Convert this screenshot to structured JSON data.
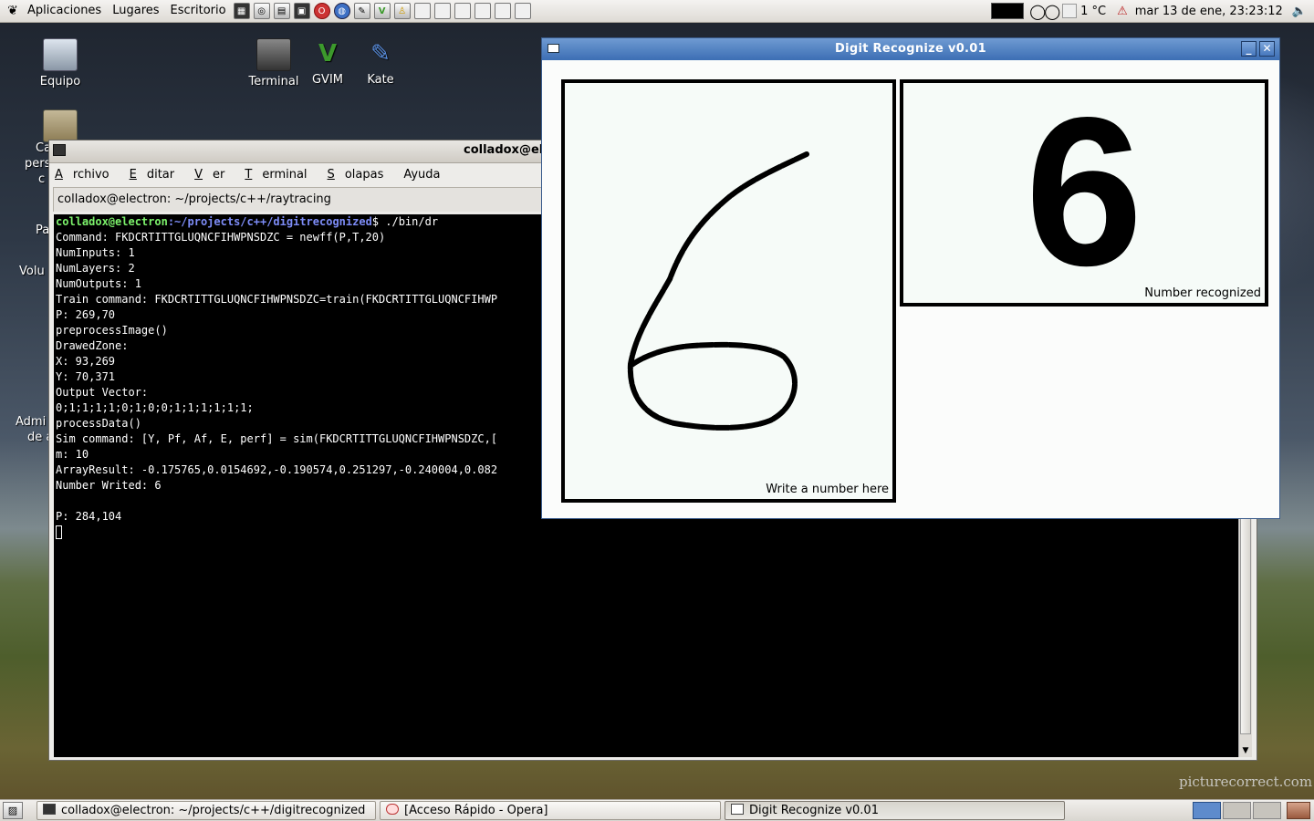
{
  "top_panel": {
    "menus": [
      "Aplicaciones",
      "Lugares",
      "Escritorio"
    ],
    "launchers": [
      "calculator-icon",
      "network-icon",
      "archive-icon",
      "terminal-icon",
      "opera-icon",
      "browser-icon",
      "tools-icon",
      "gvim-icon",
      "user-icon",
      "window-icon-1",
      "window-icon-2",
      "window-icon-3",
      "window-icon-4",
      "window-icon-5",
      "window-icon-6"
    ],
    "temperature": "1 °C",
    "clock": "mar 13 de ene, 23:23:12"
  },
  "desktop": {
    "icons": [
      {
        "label": "Equipo",
        "icon": "computer-icon"
      },
      {
        "label": "Terminal",
        "icon": "terminal-icon"
      },
      {
        "label": "GVIM",
        "icon": "gvim-icon"
      },
      {
        "label": "Kate",
        "icon": "kate-icon"
      }
    ],
    "fragments": [
      "Ca",
      "pers",
      "c",
      "Pa",
      "Volu",
      "Admi",
      "de a"
    ],
    "watermark": "picturecorrect.com"
  },
  "terminal": {
    "title": "colladox@el",
    "menus": [
      {
        "mnemonic": "A",
        "rest": "rchivo"
      },
      {
        "mnemonic": "E",
        "rest": "ditar"
      },
      {
        "mnemonic": "V",
        "rest": "er"
      },
      {
        "mnemonic": "T",
        "rest": "erminal"
      },
      {
        "mnemonic": "S",
        "rest": "olapas"
      },
      {
        "mnemonic": "",
        "rest": "Ayuda"
      }
    ],
    "tab_label": "colladox@electron: ~/projects/c++/raytracing",
    "prompt_user": "colladox@electron",
    "prompt_path": ":~/projects/c++/digitrecognized",
    "prompt_cmd": "$ ./bin/dr",
    "lines": [
      "Command: FKDCRTITTGLUQNCFIHWPNSDZC = newff(P,T,20)",
      "NumInputs: 1",
      "NumLayers: 2",
      "NumOutputs: 1",
      "Train command: FKDCRTITTGLUQNCFIHWPNSDZC=train(FKDCRTITTGLUQNCFIHWP",
      "P: 269,70",
      "preprocessImage()",
      "DrawedZone:",
      "X: 93,269",
      "Y: 70,371",
      "Output Vector:",
      "0;1;1;1;1;0;1;0;0;1;1;1;1;1;1;",
      "processData()",
      "Sim command: [Y, Pf, Af, E, perf] = sim(FKDCRTITTGLUQNCFIHWPNSDZC,[",
      "m: 10",
      "ArrayResult: -0.175765,0.0154692,-0.190574,0.251297,-0.240004,0.082",
      "Number Writed: 6",
      "",
      "P: 284,104"
    ]
  },
  "digit_app": {
    "title": "Digit Recognize v0.01",
    "drawing_caption": "Write a number here",
    "recognized_digit": "6",
    "result_caption": "Number recognized"
  },
  "taskbar": {
    "tasks": [
      {
        "label": "colladox@electron: ~/projects/c++/digitrecognized",
        "icon": "terminal-icon"
      },
      {
        "label": "[Acceso Rápido - Opera]",
        "icon": "opera-icon"
      },
      {
        "label": "Digit Recognize v0.01",
        "icon": "window-icon"
      }
    ],
    "workspaces": 4,
    "active_workspace": 1
  },
  "colors": {
    "prompt_user": "#7cf26b",
    "prompt_path": "#7d8cf7",
    "titlebar_active": "#3c6eb4"
  }
}
